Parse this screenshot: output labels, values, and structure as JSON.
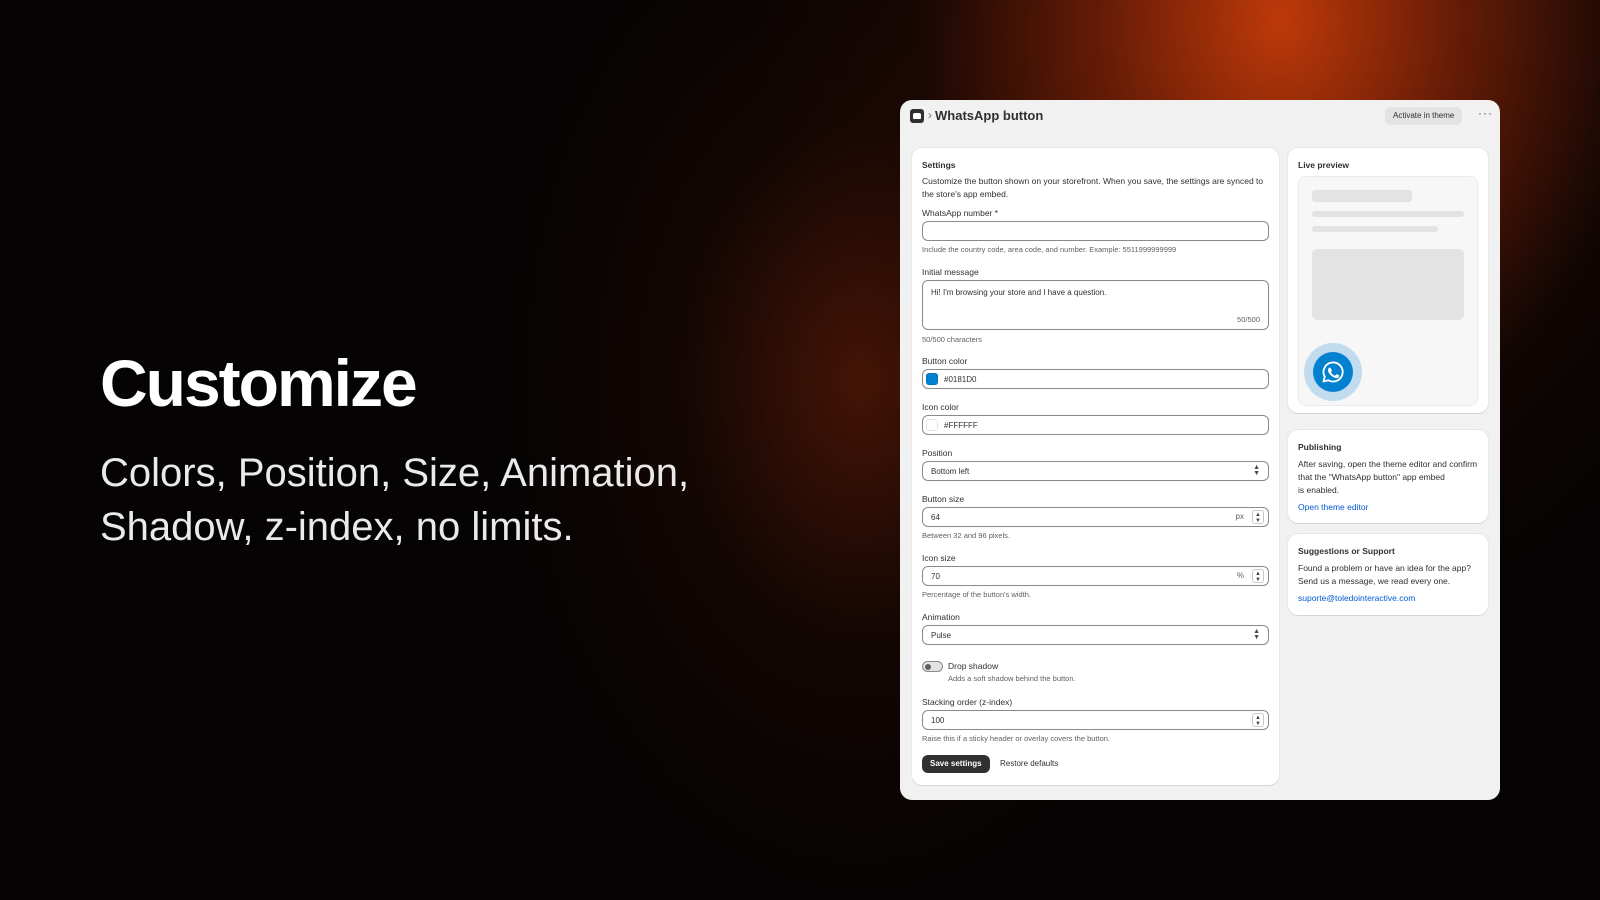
{
  "hero": {
    "title": "Customize",
    "subtitle_line1": "Colors, Position, Size, Animation,",
    "subtitle_line2": "Shadow, z-index, no limits."
  },
  "app": {
    "breadcrumb_separator": "›",
    "title": "WhatsApp button",
    "activate_label": "Activate in theme",
    "more_icon": "more-horizontal-icon"
  },
  "settings": {
    "title": "Settings",
    "description_line1": "Customize the button shown on your storefront. When you save, the settings are synced to",
    "description_line2": "the store's app embed.",
    "whatsapp_number": {
      "label": "WhatsApp number *",
      "value": "",
      "help": "Include the country code, area code, and number. Example: 5511999999999"
    },
    "initial_message": {
      "label": "Initial message",
      "value": "Hi! I'm browsing your store and I have a question.",
      "counter": "50/500",
      "help": "50/500 characters"
    },
    "button_color": {
      "label": "Button color",
      "value": "#0181D0",
      "swatch": "#0181D0"
    },
    "icon_color": {
      "label": "Icon color",
      "value": "#FFFFFF",
      "swatch": "#FFFFFF"
    },
    "position": {
      "label": "Position",
      "value": "Bottom left"
    },
    "button_size": {
      "label": "Button size",
      "value": "64",
      "unit": "px",
      "help": "Between 32 and 96 pixels."
    },
    "icon_size": {
      "label": "Icon size",
      "value": "70",
      "unit": "%",
      "help": "Percentage of the button's width."
    },
    "animation": {
      "label": "Animation",
      "value": "Pulse"
    },
    "drop_shadow": {
      "label": "Drop shadow",
      "help": "Adds a soft shadow behind the button.",
      "enabled": false
    },
    "z_index": {
      "label": "Stacking order (z-index)",
      "value": "100",
      "help": "Raise this if a sticky header or overlay covers the button."
    },
    "save_label": "Save settings",
    "restore_label": "Restore defaults"
  },
  "preview": {
    "title": "Live preview",
    "button_color": "#0181D0",
    "icon": "whatsapp-icon"
  },
  "publishing": {
    "title": "Publishing",
    "line1": "After saving, open the theme editor and confirm",
    "line2": "that the \"WhatsApp button\" app embed",
    "line3": "is enabled.",
    "link": "Open theme editor"
  },
  "support": {
    "title": "Suggestions or Support",
    "line1": "Found a problem or have an idea for the app?",
    "line2": "Send us a message, we read every one.",
    "email": "suporte@toledointeractive.com"
  }
}
